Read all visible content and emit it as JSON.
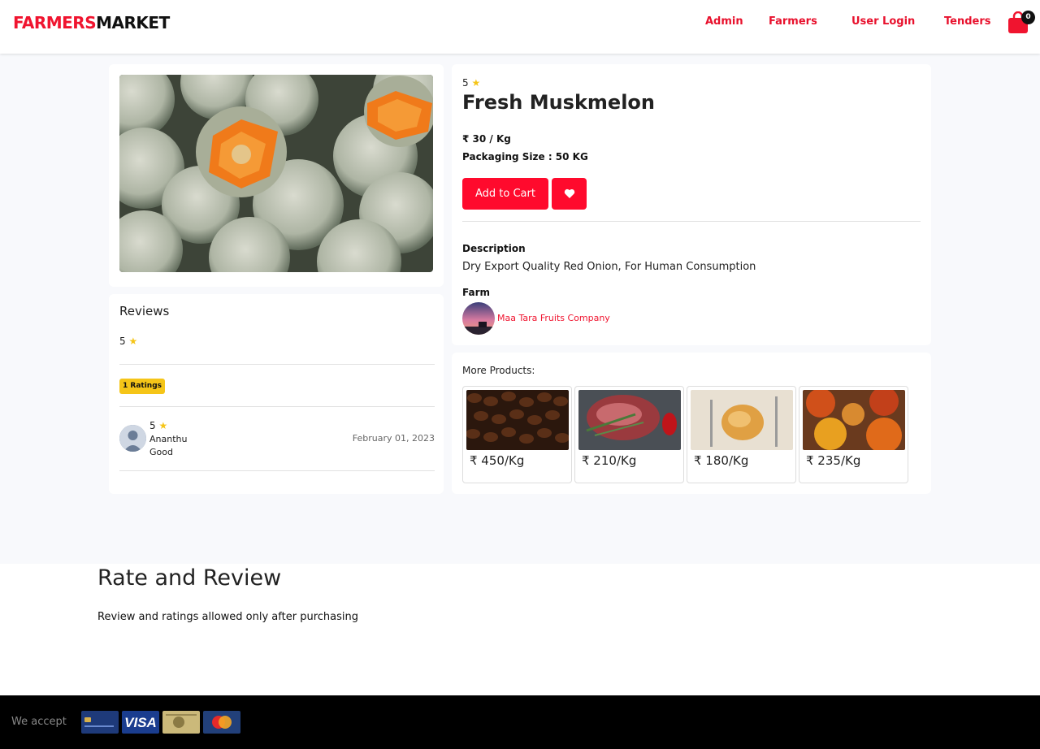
{
  "header": {
    "logo_part1": "FARMERS",
    "logo_part2": "MARKET",
    "nav": [
      "Admin",
      "Farmers",
      "User Login",
      "Tenders"
    ],
    "cart_count": "0"
  },
  "colors": {
    "brand_red": "#ff0a2d",
    "star_yellow": "#f5c518",
    "footer_black": "#000000"
  },
  "product": {
    "rating": "5",
    "title": "Fresh Muskmelon",
    "price": "₹ 30 / Kg",
    "packaging": "Packaging Size : 50 KG",
    "add_to_cart": "Add to Cart",
    "wishlist_icon": "heart-icon",
    "description_label": "Description",
    "description": "Dry Export Quality Red Onion, For Human Consumption",
    "farm_label": "Farm",
    "farm_name": "Maa Tara Fruits Company"
  },
  "reviews": {
    "title": "Reviews",
    "average": "5",
    "ratings_badge": "1 Ratings",
    "items": [
      {
        "rating": "5",
        "user": "Ananthu",
        "comment": "Good",
        "date": "February 01, 2023"
      }
    ]
  },
  "more_products": {
    "title": "More Products:",
    "items": [
      {
        "price": "₹ 450/Kg",
        "image": "coffee-beans"
      },
      {
        "price": "₹ 210/Kg",
        "image": "raw-meat"
      },
      {
        "price": "₹ 180/Kg",
        "image": "roast-chicken"
      },
      {
        "price": "₹ 235/Kg",
        "image": "spices"
      }
    ]
  },
  "rate_review": {
    "title": "Rate and Review",
    "note": "Review and ratings allowed only after purchasing"
  },
  "footer": {
    "we_accept": "We accept",
    "cards": [
      "card-logo",
      "VISA",
      "amex-card",
      "mastercard"
    ]
  }
}
